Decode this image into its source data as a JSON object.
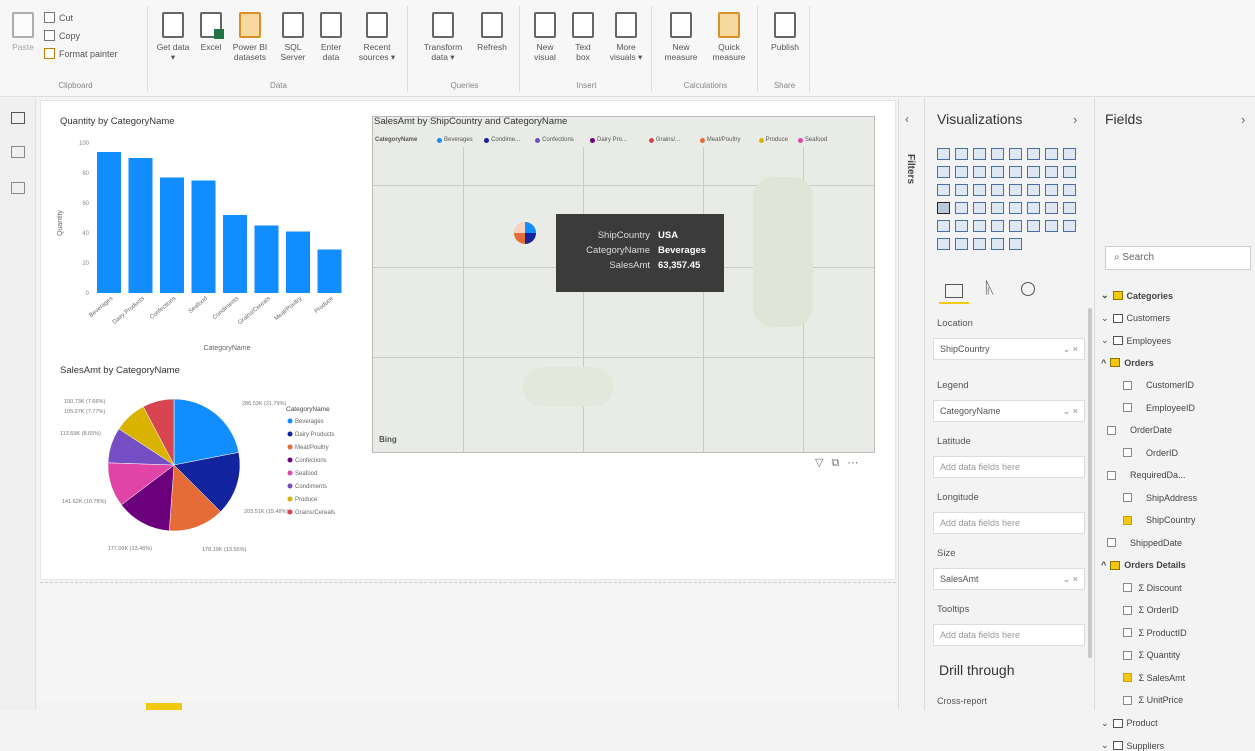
{
  "ribbon": {
    "clipboard": {
      "paste": "Paste",
      "cut": "Cut",
      "copy": "Copy",
      "format_painter": "Format painter",
      "label": "Clipboard"
    },
    "data": {
      "get_data": "Get data ▾",
      "excel": "Excel",
      "power_bi": "Power BI datasets",
      "sql": "SQL Server",
      "enter": "Enter data",
      "recent": "Recent sources ▾",
      "label": "Data"
    },
    "queries": {
      "transform": "Transform data ▾",
      "refresh": "Refresh",
      "label": "Queries"
    },
    "insert": {
      "new_visual": "New visual",
      "text_box": "Text box",
      "more_visuals": "More visuals ▾",
      "label": "Insert"
    },
    "calculations": {
      "new_measure": "New measure",
      "quick_measure": "Quick measure",
      "label": "Calculations"
    },
    "share": {
      "publish": "Publish",
      "label": "Share"
    }
  },
  "bar_chart": {
    "title": "Quantity by CategoryName",
    "ylabel": "Quantity",
    "xlabel": "CategoryName",
    "yticks": [
      "100",
      "80",
      "60",
      "40",
      "20",
      "0"
    ],
    "color": "#118DFF"
  },
  "pie_chart": {
    "title": "SalesAmt by CategoryName",
    "legend_title": "CategoryName",
    "labels": [
      "286.53K (21.79%)",
      "203.51K (15.48%)",
      "178.19K (13.55%)",
      "177.09K (13.46%)",
      "141.62K (10.78%)",
      "113.69K (8.65%)",
      "105.27K (7.77%)",
      "100.73K (7.66%)"
    ]
  },
  "map": {
    "title": "SalesAmt by ShipCountry and CategoryName",
    "legend_title": "CategoryName",
    "legend": [
      "Beverages",
      "Condime...",
      "Confections",
      "Dairy Pro...",
      "Grains/...",
      "Meat/Poultry",
      "Produce",
      "Seafood"
    ],
    "bing": "Bing",
    "tooltip": {
      "k1": "ShipCountry",
      "v1": "USA",
      "k2": "CategoryName",
      "v2": "Beverages",
      "k3": "SalesAmt",
      "v3": "63,357.45"
    }
  },
  "filters_label": "Filters",
  "visualizations": {
    "title": "Visualizations",
    "wells": {
      "location_label": "Location",
      "location_value": "ShipCountry",
      "legend_label": "Legend",
      "legend_value": "CategoryName",
      "latitude_label": "Latitude",
      "latitude_placeholder": "Add data fields here",
      "longitude_label": "Longitude",
      "longitude_placeholder": "Add data fields here",
      "size_label": "Size",
      "size_value": "SalesAmt",
      "tooltips_label": "Tooltips",
      "tooltips_placeholder": "Add data fields here"
    },
    "drill_through": "Drill through",
    "cross_report": "Cross-report"
  },
  "fields": {
    "title": "Fields",
    "search_placeholder": "Search",
    "tables": {
      "categories": "Categories",
      "customers": "Customers",
      "employees": "Employees",
      "orders": "Orders",
      "orders_details": "Orders Details",
      "product": "Product",
      "suppliers": "Suppliers"
    },
    "orders_fields": [
      "CustomerID",
      "EmployeeID",
      "OrderDate",
      "OrderID",
      "RequiredDa...",
      "ShipAddress",
      "ShipCountry",
      "ShippedDate"
    ],
    "details_fields": [
      "Discount",
      "OrderID",
      "ProductID",
      "Quantity",
      "SalesAmt",
      "UnitPrice"
    ]
  },
  "chart_data": [
    {
      "type": "bar",
      "title": "Quantity by CategoryName",
      "xlabel": "CategoryName",
      "ylabel": "Quantity",
      "categories": [
        "Beverages",
        "Dairy Products",
        "Confections",
        "Seafood",
        "Condiments",
        "Grains/Cereals",
        "Meat/Poultry",
        "Produce"
      ],
      "values": [
        94,
        90,
        77,
        75,
        52,
        45,
        41,
        29
      ],
      "ylim": [
        0,
        100
      ]
    },
    {
      "type": "pie",
      "title": "SalesAmt by CategoryName",
      "categories": [
        "Beverages",
        "Dairy Products",
        "Meat/Poultry",
        "Confections",
        "Seafood",
        "Condiments",
        "Produce",
        "Grains/Cereals"
      ],
      "values": [
        286.53,
        203.51,
        178.19,
        177.09,
        141.62,
        113.69,
        105.27,
        100.73
      ],
      "colors": [
        "#118DFF",
        "#12239E",
        "#E66C37",
        "#6B007B",
        "#E044A7",
        "#744EC2",
        "#D9B300",
        "#D64550"
      ]
    }
  ]
}
